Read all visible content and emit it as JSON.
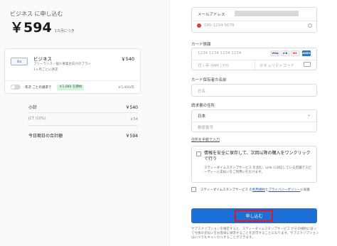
{
  "summary_header": {
    "title": "ビジネス に申し込む",
    "price": "￥594",
    "price_unit": "1カ月につき"
  },
  "plan": {
    "logo_text": "Sta",
    "name": "ビジネス",
    "description": "フリーランス・個人事業主向けのプラン",
    "billing_cycle": "1ヶ月ごとに請求",
    "price": "￥540",
    "annual_toggle_label": "年次 ごとの請求で",
    "annual_save_badge": "￥1,080 を節約",
    "annual_price": "￥5,400/年"
  },
  "totals": {
    "subtotal_label": "小計",
    "subtotal_value": "￥540",
    "tax_label": "JCT (10%)",
    "tax_value": "￥54",
    "total_label": "今日期日の合計額",
    "total_value": "￥594"
  },
  "form": {
    "email_label": "メールアドレス",
    "phone_flag": "🇯🇵",
    "phone_placeholder": "090-1234-5678",
    "card_info_label": "カード情報",
    "card_number_placeholder": "1234 1234 1234 1234",
    "card_brands": [
      "VISA",
      "JCB",
      "MC",
      "AMEX"
    ],
    "expiry_placeholder": "月 / 年 (MM / YY)",
    "cvc_placeholder": "セキュリティコード",
    "cardholder_label": "カード保有者の名前",
    "cardholder_placeholder": "氏名",
    "billing_address_label": "請求書の住所",
    "country_value": "日本",
    "postal_placeholder": "郵便番号",
    "manual_address_link": "住所を手動で入力",
    "save_info_title": "情報を安全に保存して、次回以降の購入をワンクリックで行う",
    "save_info_note": "スティーダイムスタンプサービス を含む、Link に対応している店舗でスピーディーに支払いをご利用いただけます。",
    "terms_prefix": "スティーダイムスタンプサービス の",
    "terms_link": "利用規約",
    "terms_and": "と",
    "privacy_link": "プライバシーポリシー",
    "terms_suffix": "に同意",
    "submit_label": "申し込む",
    "footer_note": "サブスクリプションを確定すると、スティーダイムスタンプサービス がその規約に従って今後の支払いをお客様に請求することを許可することになります。サブスクリプションはいつでもキャンセルすることができます。"
  },
  "colors": {
    "accent": "#1c6fd6",
    "focus_ring": "#e0142a",
    "save_badge_bg": "#d9f2df",
    "save_badge_text": "#1e7b34"
  }
}
